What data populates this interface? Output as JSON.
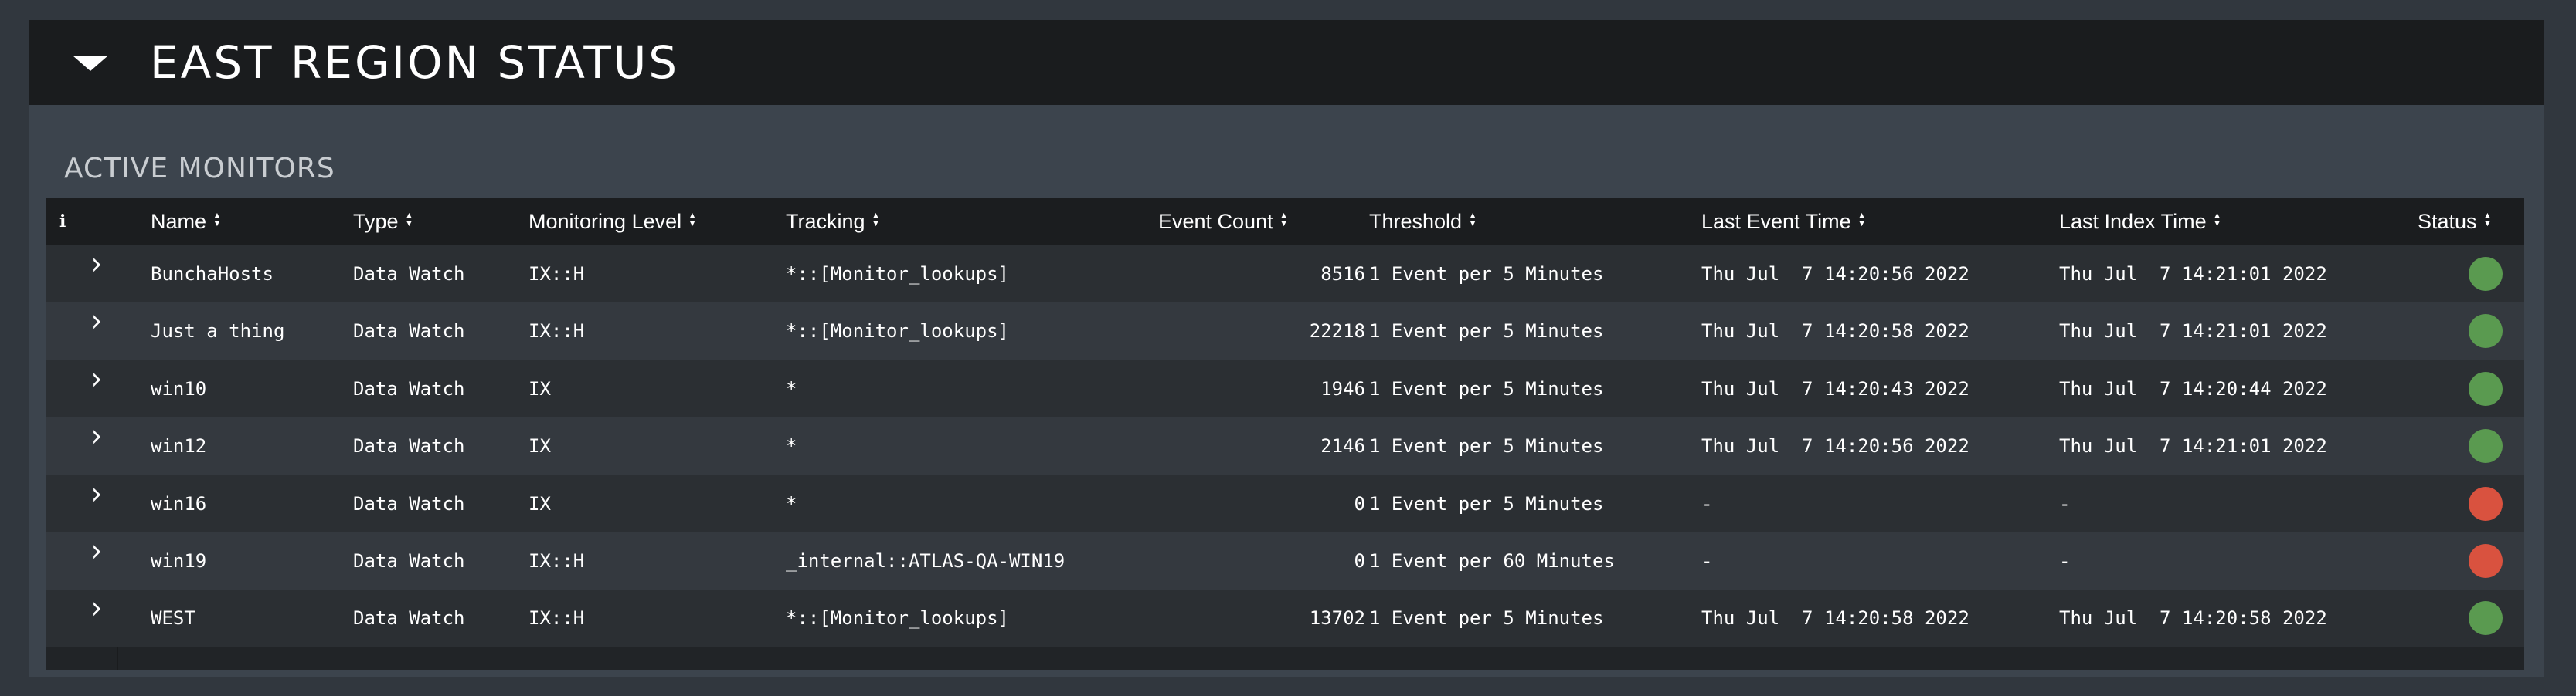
{
  "panel": {
    "title": "EAST REGION STATUS"
  },
  "section": {
    "title": "ACTIVE MONITORS"
  },
  "table": {
    "info_glyph": "i",
    "columns": [
      "Name",
      "Type",
      "Monitoring Level",
      "Tracking",
      "Event Count",
      "Threshold",
      "Last Event Time",
      "Last Index Time",
      "Status"
    ],
    "rows": [
      {
        "name": "BunchaHosts",
        "type": "Data Watch",
        "level": "IX::H",
        "tracking": "*::[Monitor_lookups]",
        "count": "8516",
        "threshold": "1 Event per 5 Minutes",
        "last_event": "Thu Jul  7 14:20:56 2022",
        "last_index": "Thu Jul  7 14:21:01 2022",
        "status": "ok"
      },
      {
        "name": "Just a thing",
        "type": "Data Watch",
        "level": "IX::H",
        "tracking": "*::[Monitor_lookups]",
        "count": "22218",
        "threshold": "1 Event per 5 Minutes",
        "last_event": "Thu Jul  7 14:20:58 2022",
        "last_index": "Thu Jul  7 14:21:01 2022",
        "status": "ok"
      },
      {
        "name": "win10",
        "type": "Data Watch",
        "level": "IX",
        "tracking": "*",
        "count": "1946",
        "threshold": "1 Event per 5 Minutes",
        "last_event": "Thu Jul  7 14:20:43 2022",
        "last_index": "Thu Jul  7 14:20:44 2022",
        "status": "ok"
      },
      {
        "name": "win12",
        "type": "Data Watch",
        "level": "IX",
        "tracking": "*",
        "count": "2146",
        "threshold": "1 Event per 5 Minutes",
        "last_event": "Thu Jul  7 14:20:56 2022",
        "last_index": "Thu Jul  7 14:21:01 2022",
        "status": "ok"
      },
      {
        "name": "win16",
        "type": "Data Watch",
        "level": "IX",
        "tracking": "*",
        "count": "0",
        "threshold": "1 Event per 5 Minutes",
        "last_event": "-",
        "last_index": "-",
        "status": "alert"
      },
      {
        "name": "win19",
        "type": "Data Watch",
        "level": "IX::H",
        "tracking": "_internal::ATLAS-QA-WIN19",
        "count": "0",
        "threshold": "1 Event per 60 Minutes",
        "last_event": "-",
        "last_index": "-",
        "status": "alert"
      },
      {
        "name": "WEST",
        "type": "Data Watch",
        "level": "IX::H",
        "tracking": "*::[Monitor_lookups]",
        "count": "13702",
        "threshold": "1 Event per 5 Minutes",
        "last_event": "Thu Jul  7 14:20:58 2022",
        "last_index": "Thu Jul  7 14:20:58 2022",
        "status": "ok"
      }
    ]
  },
  "colors": {
    "ok": "#5a9a50",
    "alert": "#d9523f"
  },
  "icons": {
    "collapse": "caret-down-icon",
    "info": "info-icon",
    "sort": "sort-icon",
    "expand": "chevron-right-icon"
  }
}
